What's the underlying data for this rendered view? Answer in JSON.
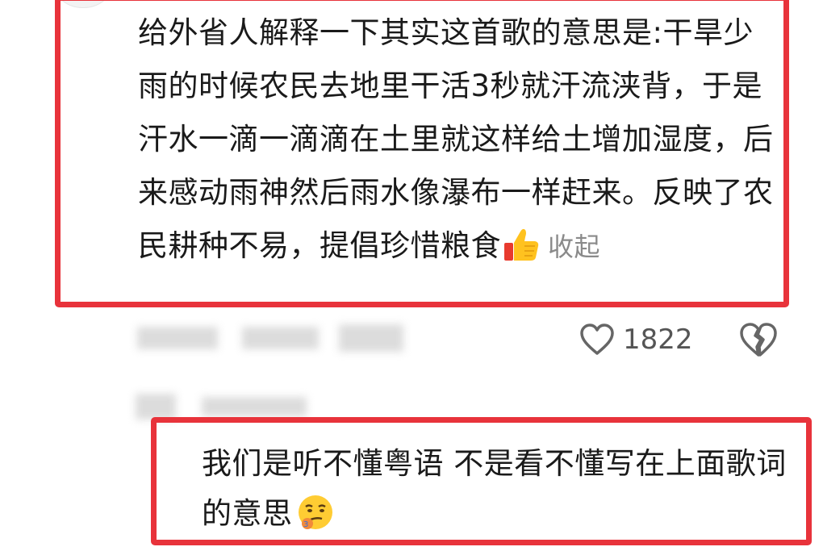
{
  "comment": {
    "text": "给外省人解释一下其实这首歌的意思是:干旱少雨的时候农民去地里干活3秒就汗流浃背，于是汗水一滴一滴滴在土里就这样给土增加湿度，后来感动雨神然后雨水像瀑布一样赶来。反映了农民耕种不易，提倡珍惜粮食",
    "emoji": "thumbs-up-icon",
    "collapse_label": "收起",
    "likes": "1822"
  },
  "reply": {
    "text": "我们是听不懂粤语 不是看不懂写在上面歌词的意思",
    "emoji": "smirk-face-icon"
  },
  "colors": {
    "highlight": "#e8333b",
    "text": "#1a1a1a",
    "muted": "#8a8a8a"
  }
}
